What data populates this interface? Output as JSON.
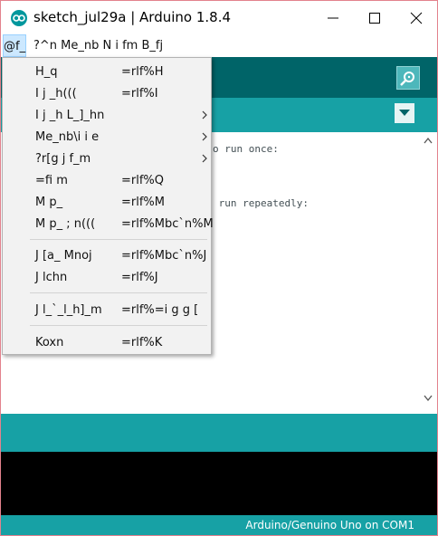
{
  "window": {
    "title": "sketch_jul29a | Arduino 1.8.4",
    "controls": [
      "minimize-icon",
      "maximize-icon",
      "close-icon"
    ]
  },
  "menubar": {
    "file": "@f_",
    "rest": "?^n Me_nb N i fm B_fj"
  },
  "file_menu": {
    "items": [
      {
        "label": "H_q",
        "shortcut": "=rlf%H",
        "submenu": false
      },
      {
        "label": "I j _h(((",
        "shortcut": "=rlf%I",
        "submenu": false
      },
      {
        "label": "I j _h L_]_hn",
        "shortcut": "",
        "submenu": true
      },
      {
        "label": "Me_nb\\i i e",
        "shortcut": "",
        "submenu": true
      },
      {
        "label": "?r[g j f_m",
        "shortcut": "",
        "submenu": true
      },
      {
        "label": "=fi m",
        "shortcut": "=rlf%Q",
        "submenu": false
      },
      {
        "label": "M p_",
        "shortcut": "=rlf%M",
        "submenu": false
      },
      {
        "label": "M p_ ; n(((",
        "shortcut": "=rlf%Mbc`n%M",
        "submenu": false
      },
      {
        "label": "J [a_ Mnoj",
        "shortcut": "=rlf%Mbc`n%J",
        "submenu": false
      },
      {
        "label": "J lchn",
        "shortcut": "=rlf%J",
        "submenu": false
      },
      {
        "label": "J l_`_l_h]_m",
        "shortcut": "=rlf%=i g g [",
        "submenu": false
      },
      {
        "label": "Koxn",
        "shortcut": "=rlf%K",
        "submenu": false
      }
    ]
  },
  "editor": {
    "code_fragments": [
      "o run once:",
      " run repeatedly:"
    ]
  },
  "status": {
    "board": "Arduino/Genuino Uno on COM1"
  },
  "colors": {
    "toolbar": "#006468",
    "teal": "#17a1a5",
    "menu_highlight": "#cce8ff",
    "window_border": "#e3828d"
  }
}
